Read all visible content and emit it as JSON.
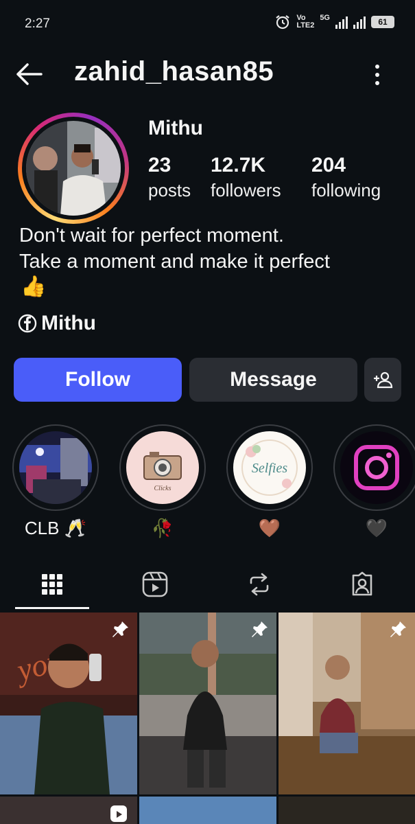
{
  "status_bar": {
    "time": "2:27",
    "network_label": "Vo LTE2",
    "network_type": "5G",
    "battery": "61"
  },
  "header": {
    "username": "zahid_hasan85"
  },
  "profile": {
    "display_name": "Mithu",
    "stats": [
      {
        "value": "23",
        "label": "posts"
      },
      {
        "value": "12.7K",
        "label": "followers"
      },
      {
        "value": "204",
        "label": "following"
      }
    ],
    "bio_line1": "Don't wait for perfect moment.",
    "bio_line2": "Take a moment and make it perfect",
    "bio_emoji": "👍",
    "link_label": "Mithu",
    "link_icon": "facebook-icon"
  },
  "actions": {
    "follow": "Follow",
    "message": "Message",
    "add_friend_icon": "person-add-icon"
  },
  "highlights": [
    {
      "label": "CLB 🥂"
    },
    {
      "label": "🥀"
    },
    {
      "label": "🤎"
    },
    {
      "label": "🖤"
    }
  ],
  "highlight_texts": {
    "clicks": "Clicks",
    "selfies": "Selfies"
  },
  "tabs": [
    {
      "icon": "grid-icon",
      "active": true
    },
    {
      "icon": "reels-icon",
      "active": false
    },
    {
      "icon": "reposts-icon",
      "active": false
    },
    {
      "icon": "tagged-icon",
      "active": false
    }
  ],
  "colors": {
    "follow_button": "#4a5df9",
    "background": "#0c1014",
    "secondary_button": "#2a2d33"
  }
}
